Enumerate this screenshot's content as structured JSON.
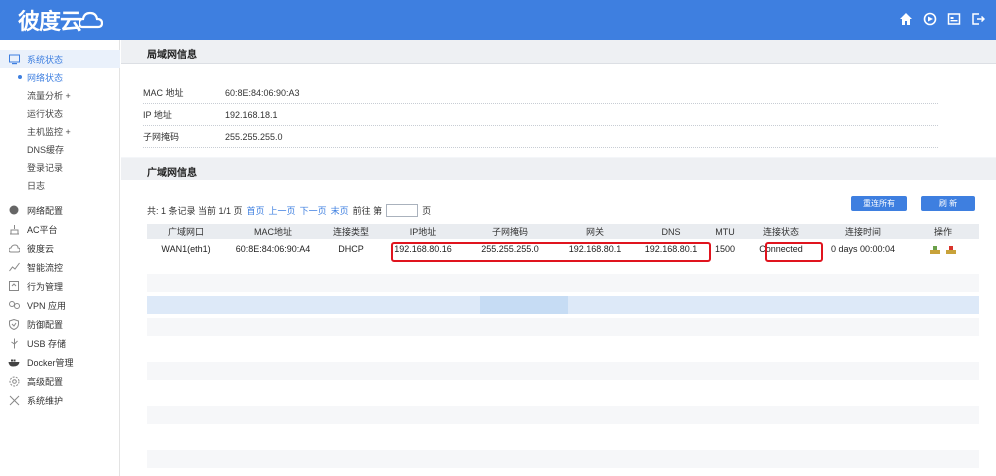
{
  "header": {
    "logo_text": "彼度云",
    "icons": [
      "home-icon",
      "refresh-icon",
      "window-icon",
      "logout-icon"
    ]
  },
  "sidebar": {
    "items": [
      {
        "label": "系统状态",
        "icon": "monitor-icon",
        "active": true
      },
      {
        "label": "网络配置",
        "icon": "globe-icon"
      },
      {
        "label": "AC平台",
        "icon": "ac-icon"
      },
      {
        "label": "彼度云",
        "icon": "cloud-icon"
      },
      {
        "label": "智能流控",
        "icon": "chart-icon"
      },
      {
        "label": "行为管理",
        "icon": "behavior-icon"
      },
      {
        "label": "VPN 应用",
        "icon": "vpn-icon"
      },
      {
        "label": "防御配置",
        "icon": "shield-icon"
      },
      {
        "label": "USB 存储",
        "icon": "usb-icon"
      },
      {
        "label": "Docker管理",
        "icon": "docker-icon"
      },
      {
        "label": "高级配置",
        "icon": "gear-icon"
      },
      {
        "label": "系统维护",
        "icon": "tools-icon"
      }
    ],
    "sub_items": [
      {
        "label": "网络状态",
        "active": true
      },
      {
        "label": "流量分析 +"
      },
      {
        "label": "运行状态"
      },
      {
        "label": "主机监控 +"
      },
      {
        "label": "DNS缓存"
      },
      {
        "label": "登录记录"
      },
      {
        "label": "日志"
      }
    ]
  },
  "lan": {
    "title": "局域网信息",
    "rows": [
      {
        "key": "MAC 地址",
        "value": "60:8E:84:06:90:A3"
      },
      {
        "key": "IP 地址",
        "value": "192.168.18.1"
      },
      {
        "key": "子网掩码",
        "value": "255.255.255.0"
      }
    ]
  },
  "wan": {
    "title": "广域网信息",
    "pager": {
      "summary": "共: 1 条记录 当前 1/1 页",
      "first": "首页",
      "prev": "上一页",
      "next": "下一页",
      "last": "末页",
      "goto": "前往 第",
      "page_suffix": "页",
      "page_input": ""
    },
    "buttons": {
      "redial_all": "重连所有",
      "refresh": "刷 新"
    },
    "columns": [
      "广域网口",
      "MAC地址",
      "连接类型",
      "IP地址",
      "子网掩码",
      "网关",
      "DNS",
      "MTU",
      "连接状态",
      "连接时间",
      "操作"
    ],
    "rows": [
      [
        "WAN1(eth1)",
        "60:8E:84:06:90:A4",
        "DHCP",
        "192.168.80.16",
        "255.255.255.0",
        "192.168.80.1",
        "192.168.80.1",
        "1500",
        "Connected",
        "0 days 00:00:04",
        ""
      ]
    ]
  },
  "colors": {
    "accent": "#3e7fe0",
    "highlight": "#e0141e",
    "row_selected": "#dde9f8"
  }
}
